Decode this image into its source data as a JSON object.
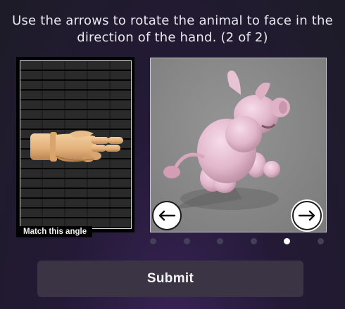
{
  "instructions": {
    "line1": "Use the arrows to rotate the animal to face in the",
    "line2": "direction of the hand. (2 of 2)"
  },
  "reference": {
    "label": "Match this angle",
    "image": "wooden-hand-pointing-right"
  },
  "view": {
    "image": "pink-pig-3d-model",
    "left_arrow_icon": "arrow-left-icon",
    "right_arrow_icon": "arrow-right-icon"
  },
  "pagination": {
    "count": 6,
    "active_index": 4
  },
  "submit": {
    "label": "Submit"
  },
  "colors": {
    "background": "#1d1b27",
    "submit_bg": "#3a3445",
    "dot_inactive": "#45405a",
    "dot_active": "#ffffff"
  }
}
